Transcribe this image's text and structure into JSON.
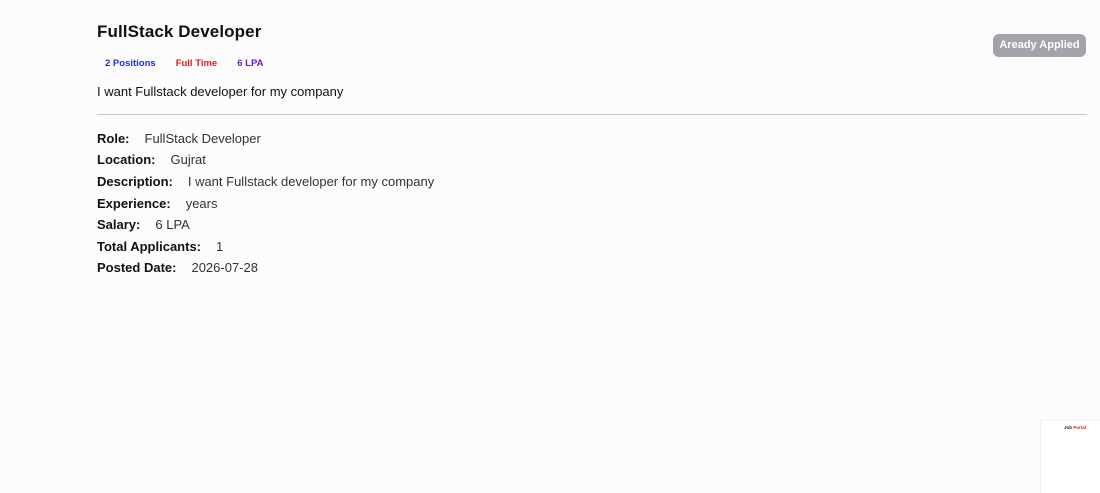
{
  "job": {
    "title": "FullStack Developer",
    "badges": {
      "positions": "2 Positions",
      "type": "Full Time",
      "salary": "6 LPA"
    },
    "summary": "I want Fullstack developer for my company",
    "apply_button_label": "Aready Applied"
  },
  "details": {
    "role": {
      "label": "Role:",
      "value": "FullStack Developer"
    },
    "location": {
      "label": "Location:",
      "value": "Gujrat"
    },
    "description": {
      "label": "Description:",
      "value": "I want Fullstack developer for my company"
    },
    "experience": {
      "label": "Experience:",
      "value": "years"
    },
    "salary": {
      "label": "Salary:",
      "value": "6 LPA"
    },
    "applicants": {
      "label": "Total Applicants:",
      "value": "1"
    },
    "posted": {
      "label": "Posted Date:",
      "value": "2026-07-28"
    }
  },
  "corner_widget": {
    "brand_part1": "Job",
    "brand_part2": "Portal"
  },
  "colors": {
    "background": "#fdfcfd",
    "badge_blue": "#1e2fd4",
    "badge_red": "#d42020",
    "badge_purple": "#6a1bb8",
    "button_disabled": "#a3a3aa",
    "divider": "#c8c7d8"
  }
}
